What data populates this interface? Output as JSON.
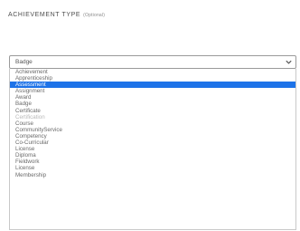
{
  "field": {
    "label": "ACHIEVEMENT TYPE",
    "optional_note": "(Optional)"
  },
  "select": {
    "current_value": "Badge",
    "icon": "chevron-down-icon"
  },
  "options": [
    {
      "label": "Achievement",
      "state": "normal"
    },
    {
      "label": "Apprenticeship",
      "state": "normal"
    },
    {
      "label": "Assessment",
      "state": "normal"
    },
    {
      "label": "Assignment",
      "state": "normal"
    },
    {
      "label": "Award",
      "state": "normal"
    },
    {
      "label": "Badge",
      "state": "normal"
    },
    {
      "label": "Certificate",
      "state": "normal"
    },
    {
      "label": "Certification",
      "state": "disabled"
    },
    {
      "label": "Course",
      "state": "normal"
    },
    {
      "label": "CommunityService",
      "state": "normal"
    },
    {
      "label": "Competency",
      "state": "normal"
    },
    {
      "label": "Co-Curricular",
      "state": "normal"
    },
    {
      "label": "License",
      "state": "normal"
    },
    {
      "label": "Diploma",
      "state": "normal"
    },
    {
      "label": "Fieldwork",
      "state": "normal"
    },
    {
      "label": "License",
      "state": "normal"
    },
    {
      "label": "Membership",
      "state": "normal"
    }
  ],
  "colors": {
    "selected_background": "#1e73e8",
    "selected_text": "#ffffff"
  }
}
